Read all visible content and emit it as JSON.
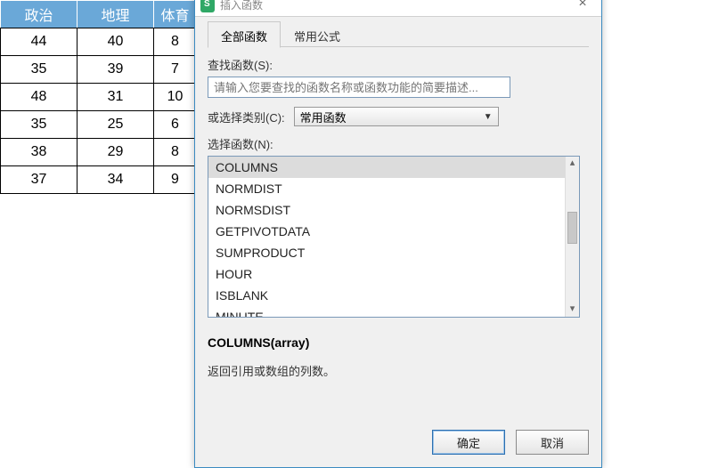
{
  "sheet": {
    "headers": [
      "政治",
      "地理",
      "体育"
    ],
    "rows": [
      [
        "44",
        "40",
        "8"
      ],
      [
        "35",
        "39",
        "7"
      ],
      [
        "48",
        "31",
        "10"
      ],
      [
        "35",
        "25",
        "6"
      ],
      [
        "38",
        "29",
        "8"
      ],
      [
        "37",
        "34",
        "9"
      ]
    ]
  },
  "dialog": {
    "title": "插入函数",
    "close_glyph": "×",
    "tabs": {
      "all": "全部函数",
      "common": "常用公式"
    },
    "search_label": "查找函数(S):",
    "search_placeholder": "请输入您要查找的函数名称或函数功能的简要描述...",
    "category_label": "或选择类别(C):",
    "category_value": "常用函数",
    "select_label": "选择函数(N):",
    "functions": [
      "COLUMNS",
      "NORMDIST",
      "NORMSDIST",
      "GETPIVOTDATA",
      "SUMPRODUCT",
      "HOUR",
      "ISBLANK",
      "MINUTE"
    ],
    "syntax": "COLUMNS(array)",
    "description": "返回引用或数组的列数。",
    "ok": "确定",
    "cancel": "取消"
  },
  "icons": {
    "dropdown": "▼",
    "scroll_up": "▴",
    "scroll_down": "▾"
  }
}
